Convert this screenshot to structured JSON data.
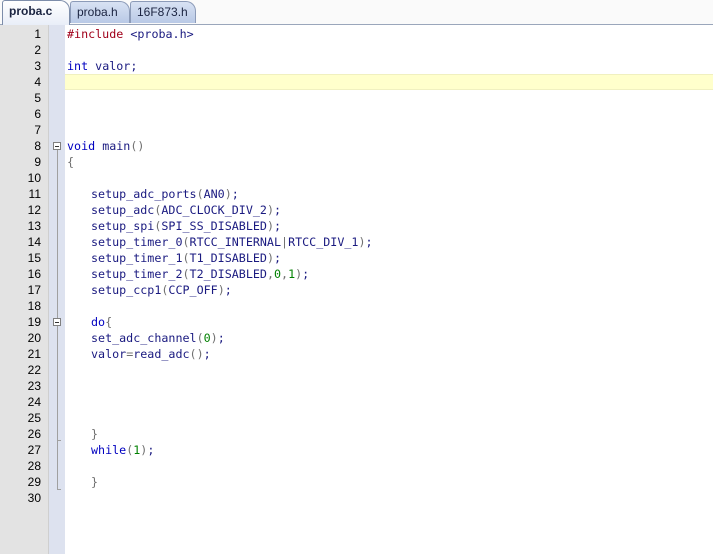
{
  "tabs": [
    {
      "label": "proba.c",
      "active": true
    },
    {
      "label": "proba.h",
      "active": false
    },
    {
      "label": "16F873.h",
      "active": false
    }
  ],
  "editor": {
    "current_line": 4,
    "lines": [
      {
        "n": "1",
        "indent": false,
        "tokens": [
          [
            "pre",
            "#include"
          ],
          [
            "id",
            " <proba.h>"
          ]
        ]
      },
      {
        "n": "2",
        "indent": false,
        "tokens": []
      },
      {
        "n": "3",
        "indent": false,
        "tokens": [
          [
            "kw",
            "int"
          ],
          [
            "id",
            " valor;"
          ]
        ]
      },
      {
        "n": "4",
        "indent": false,
        "tokens": []
      },
      {
        "n": "5",
        "indent": false,
        "tokens": []
      },
      {
        "n": "6",
        "indent": false,
        "tokens": []
      },
      {
        "n": "7",
        "indent": false,
        "tokens": []
      },
      {
        "n": "8",
        "indent": false,
        "tokens": [
          [
            "kw",
            "void"
          ],
          [
            "id",
            " main"
          ],
          [
            "p",
            "()"
          ]
        ]
      },
      {
        "n": "9",
        "indent": false,
        "tokens": [
          [
            "p",
            "{"
          ]
        ]
      },
      {
        "n": "10",
        "indent": false,
        "tokens": []
      },
      {
        "n": "11",
        "indent": true,
        "tokens": [
          [
            "id",
            "setup_adc_ports"
          ],
          [
            "p",
            "("
          ],
          [
            "id",
            "AN0"
          ],
          [
            "p",
            ")"
          ],
          [
            "id",
            ";"
          ]
        ]
      },
      {
        "n": "12",
        "indent": true,
        "tokens": [
          [
            "id",
            "setup_adc"
          ],
          [
            "p",
            "("
          ],
          [
            "id",
            "ADC_CLOCK_DIV_2"
          ],
          [
            "p",
            ")"
          ],
          [
            "id",
            ";"
          ]
        ]
      },
      {
        "n": "13",
        "indent": true,
        "tokens": [
          [
            "id",
            "setup_spi"
          ],
          [
            "p",
            "("
          ],
          [
            "id",
            "SPI_SS_DISABLED"
          ],
          [
            "p",
            ")"
          ],
          [
            "id",
            ";"
          ]
        ]
      },
      {
        "n": "14",
        "indent": true,
        "tokens": [
          [
            "id",
            "setup_timer_0"
          ],
          [
            "p",
            "("
          ],
          [
            "id",
            "RTCC_INTERNAL"
          ],
          [
            "p",
            "|"
          ],
          [
            "id",
            "RTCC_DIV_1"
          ],
          [
            "p",
            ")"
          ],
          [
            "id",
            ";"
          ]
        ]
      },
      {
        "n": "15",
        "indent": true,
        "tokens": [
          [
            "id",
            "setup_timer_1"
          ],
          [
            "p",
            "("
          ],
          [
            "id",
            "T1_DISABLED"
          ],
          [
            "p",
            ")"
          ],
          [
            "id",
            ";"
          ]
        ]
      },
      {
        "n": "16",
        "indent": true,
        "tokens": [
          [
            "id",
            "setup_timer_2"
          ],
          [
            "p",
            "("
          ],
          [
            "id",
            "T2_DISABLED"
          ],
          [
            "p",
            ","
          ],
          [
            "num",
            "0"
          ],
          [
            "p",
            ","
          ],
          [
            "num",
            "1"
          ],
          [
            "p",
            ")"
          ],
          [
            "id",
            ";"
          ]
        ]
      },
      {
        "n": "17",
        "indent": true,
        "tokens": [
          [
            "id",
            "setup_ccp1"
          ],
          [
            "p",
            "("
          ],
          [
            "id",
            "CCP_OFF"
          ],
          [
            "p",
            ")"
          ],
          [
            "id",
            ";"
          ]
        ]
      },
      {
        "n": "18",
        "indent": false,
        "tokens": []
      },
      {
        "n": "19",
        "indent": true,
        "tokens": [
          [
            "kw",
            "do"
          ],
          [
            "p",
            "{"
          ]
        ]
      },
      {
        "n": "20",
        "indent": true,
        "tokens": [
          [
            "id",
            "set_adc_channel"
          ],
          [
            "p",
            "("
          ],
          [
            "num",
            "0"
          ],
          [
            "p",
            ")"
          ],
          [
            "id",
            ";"
          ]
        ]
      },
      {
        "n": "21",
        "indent": true,
        "tokens": [
          [
            "id",
            "valor"
          ],
          [
            "p",
            "="
          ],
          [
            "id",
            "read_adc"
          ],
          [
            "p",
            "()"
          ],
          [
            "id",
            ";"
          ]
        ]
      },
      {
        "n": "22",
        "indent": false,
        "tokens": []
      },
      {
        "n": "23",
        "indent": false,
        "tokens": []
      },
      {
        "n": "24",
        "indent": false,
        "tokens": []
      },
      {
        "n": "25",
        "indent": false,
        "tokens": []
      },
      {
        "n": "26",
        "indent": true,
        "tokens": [
          [
            "p",
            "}"
          ]
        ]
      },
      {
        "n": "27",
        "indent": true,
        "tokens": [
          [
            "kw",
            "while"
          ],
          [
            "p",
            "("
          ],
          [
            "num",
            "1"
          ],
          [
            "p",
            ")"
          ],
          [
            "id",
            ";"
          ]
        ]
      },
      {
        "n": "28",
        "indent": false,
        "tokens": []
      },
      {
        "n": "29",
        "indent": true,
        "tokens": [
          [
            "p",
            "}"
          ]
        ]
      },
      {
        "n": "30",
        "indent": false,
        "tokens": []
      }
    ]
  },
  "colors": {
    "current_line_highlight": "#ffffcc",
    "preprocessor": "#a0001a",
    "keyword": "#0000c0",
    "identifier": "#1a1a80",
    "number": "#008000",
    "punctuation": "#707070"
  }
}
